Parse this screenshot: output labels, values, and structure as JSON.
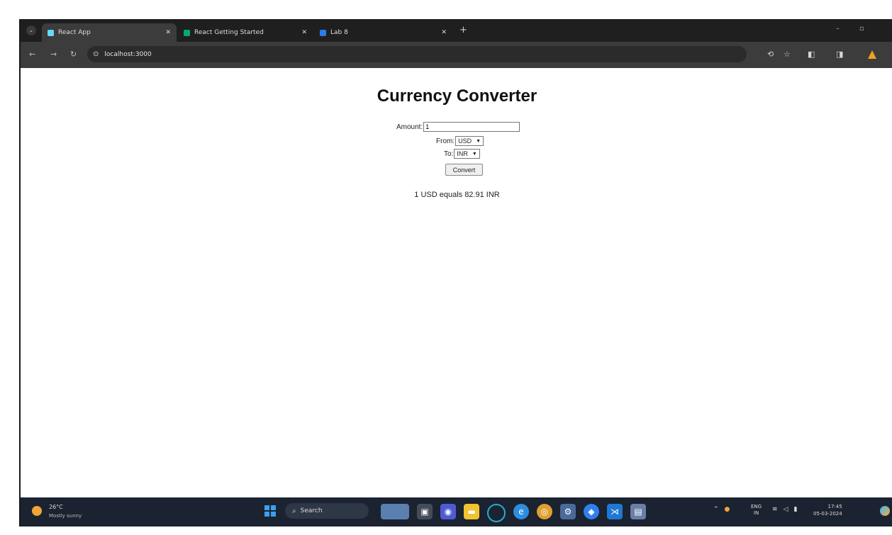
{
  "browser": {
    "tabs": [
      {
        "label": "React App",
        "favicon_color": "#61dafb",
        "active": true
      },
      {
        "label": "React Getting Started",
        "favicon_color": "#04aa6d",
        "active": false
      },
      {
        "label": "Lab 8",
        "favicon_color": "#2b7de9",
        "active": false
      }
    ],
    "new_tab": "+",
    "address": "localhost:3000"
  },
  "app": {
    "title": "Currency Converter",
    "amount_label": "Amount:",
    "amount_value": "1",
    "from_label": "From:",
    "from_value": "USD",
    "to_label": "To:",
    "to_value": "INR",
    "convert_label": "Convert",
    "result": "1 USD equals 82.91 INR"
  },
  "taskbar": {
    "weather_temp": "26°C",
    "weather_desc": "Mostly sunny",
    "search_label": "Search",
    "lang_line1": "ENG",
    "lang_line2": "IN",
    "time": "17:45",
    "date": "05-03-2024"
  }
}
